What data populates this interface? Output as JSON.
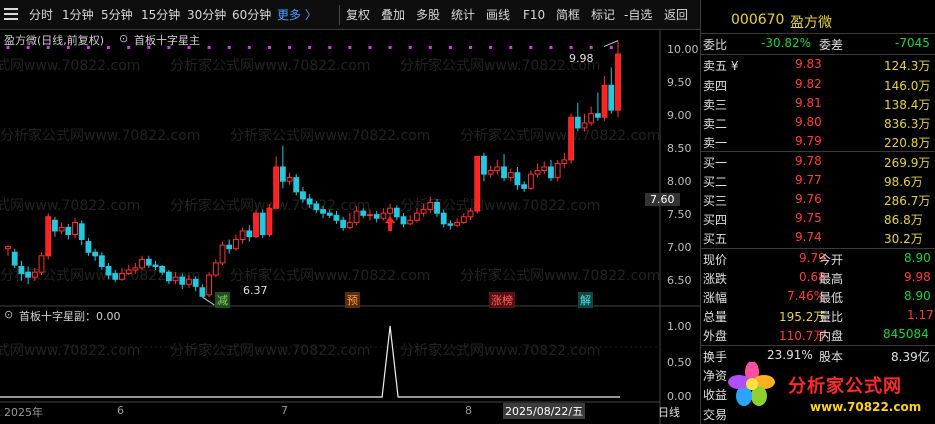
{
  "toolbar": {
    "tabs": [
      "分时",
      "1分钟",
      "5分钟",
      "15分钟",
      "30分钟",
      "60分钟"
    ],
    "more": "更多 〉",
    "buttons": [
      "复权",
      "叠加",
      "多股",
      "统计",
      "画线",
      "F10",
      "简框",
      "标记",
      "-自选",
      "返回"
    ]
  },
  "chart": {
    "title": "盈方微(日线,前复权)",
    "indicator_main": "首板十字星主",
    "indicator_sub": "首板十字星副：0.00",
    "high_label": "9.98",
    "low_label": "6.37",
    "current_price_tag": "7.60",
    "y_ticks": [
      "10.00",
      "9.50",
      "9.00",
      "8.50",
      "8.00",
      "7.50",
      "7.00",
      "6.50"
    ],
    "sub_y_ticks": [
      "1.00",
      "0.50",
      "0.00"
    ],
    "x_ticks": [
      "2025年",
      "6",
      "7",
      "8"
    ],
    "date_highlight": "2025/08/22/五",
    "period_label": "日线",
    "signals": [
      {
        "text": "减",
        "color": "#2ecc40"
      },
      {
        "text": "预",
        "color": "#ff7f00"
      },
      {
        "text": "涨榜",
        "color": "#ff3b3b"
      },
      {
        "text": "解",
        "color": "#21c6c6"
      }
    ],
    "watermark": "分析家公式网www.70822.com",
    "chart_data": {
      "type": "candlestick",
      "ylim": [
        6.3,
        10.1
      ],
      "candles": [
        [
          7.05,
          7.08,
          6.95,
          7.1
        ],
        [
          7.0,
          6.82,
          6.78,
          7.05
        ],
        [
          6.8,
          6.7,
          6.6,
          6.88
        ],
        [
          6.72,
          6.65,
          6.55,
          6.8
        ],
        [
          6.65,
          6.72,
          6.6,
          6.78
        ],
        [
          6.72,
          6.95,
          6.68,
          7.0
        ],
        [
          6.95,
          7.5,
          6.9,
          7.55
        ],
        [
          7.45,
          7.3,
          7.22,
          7.5
        ],
        [
          7.3,
          7.35,
          7.25,
          7.42
        ],
        [
          7.35,
          7.25,
          7.18,
          7.4
        ],
        [
          7.25,
          7.42,
          7.2,
          7.48
        ],
        [
          7.4,
          7.18,
          7.1,
          7.45
        ],
        [
          7.15,
          7.0,
          6.95,
          7.2
        ],
        [
          7.0,
          6.95,
          6.88,
          7.05
        ],
        [
          6.95,
          6.8,
          6.75,
          7.0
        ],
        [
          6.8,
          6.68,
          6.62,
          6.85
        ],
        [
          6.7,
          6.62,
          6.58,
          6.75
        ],
        [
          6.62,
          6.7,
          6.6,
          6.78
        ],
        [
          6.7,
          6.75,
          6.68,
          6.82
        ],
        [
          6.75,
          6.78,
          6.7,
          6.85
        ],
        [
          6.78,
          6.9,
          6.75,
          6.95
        ],
        [
          6.9,
          6.82,
          6.78,
          6.95
        ],
        [
          6.82,
          6.8,
          6.75,
          6.88
        ],
        [
          6.8,
          6.72,
          6.68,
          6.82
        ],
        [
          6.72,
          6.6,
          6.55,
          6.75
        ],
        [
          6.6,
          6.65,
          6.55,
          6.72
        ],
        [
          6.65,
          6.55,
          6.48,
          6.7
        ],
        [
          6.55,
          6.62,
          6.5,
          6.68
        ],
        [
          6.62,
          6.52,
          6.45,
          6.66
        ],
        [
          6.5,
          6.38,
          6.37,
          6.55
        ],
        [
          6.4,
          6.68,
          6.37,
          6.72
        ],
        [
          6.68,
          6.85,
          6.65,
          6.9
        ],
        [
          6.85,
          7.1,
          6.82,
          7.15
        ],
        [
          7.1,
          7.05,
          6.98,
          7.18
        ],
        [
          7.05,
          7.18,
          7.02,
          7.25
        ],
        [
          7.18,
          7.3,
          7.12,
          7.35
        ],
        [
          7.3,
          7.22,
          7.15,
          7.38
        ],
        [
          7.22,
          7.55,
          7.2,
          7.6
        ],
        [
          7.55,
          7.25,
          7.2,
          7.6
        ],
        [
          7.25,
          7.62,
          7.22,
          7.68
        ],
        [
          7.62,
          8.2,
          7.6,
          8.35
        ],
        [
          8.2,
          8.0,
          7.9,
          8.5
        ],
        [
          8.0,
          8.05,
          7.95,
          8.12
        ],
        [
          8.05,
          7.85,
          7.8,
          8.1
        ],
        [
          7.85,
          7.75,
          7.7,
          7.92
        ],
        [
          7.75,
          7.68,
          7.62,
          7.82
        ],
        [
          7.68,
          7.6,
          7.55,
          7.72
        ],
        [
          7.6,
          7.55,
          7.48,
          7.65
        ],
        [
          7.55,
          7.52,
          7.48,
          7.6
        ],
        [
          7.52,
          7.45,
          7.4,
          7.58
        ],
        [
          7.45,
          7.35,
          7.3,
          7.5
        ],
        [
          7.35,
          7.42,
          7.32,
          7.55
        ],
        [
          7.42,
          7.58,
          7.38,
          7.65
        ],
        [
          7.58,
          7.52,
          7.48,
          7.62
        ],
        [
          7.52,
          7.53,
          7.45,
          7.6
        ],
        [
          7.53,
          7.48,
          7.42,
          7.58
        ],
        [
          7.48,
          7.55,
          7.45,
          7.62
        ],
        [
          7.55,
          7.62,
          7.5,
          7.68
        ],
        [
          7.62,
          7.5,
          7.45,
          7.66
        ],
        [
          7.5,
          7.4,
          7.35,
          7.55
        ],
        [
          7.4,
          7.45,
          7.38,
          7.52
        ],
        [
          7.45,
          7.55,
          7.42,
          7.62
        ],
        [
          7.55,
          7.6,
          7.5,
          7.68
        ],
        [
          7.6,
          7.7,
          7.55,
          7.78
        ],
        [
          7.7,
          7.55,
          7.5,
          7.75
        ],
        [
          7.55,
          7.4,
          7.35,
          7.6
        ],
        [
          7.4,
          7.38,
          7.32,
          7.45
        ],
        [
          7.38,
          7.42,
          7.35,
          7.48
        ],
        [
          7.42,
          7.5,
          7.4,
          7.55
        ],
        [
          7.5,
          7.58,
          7.45,
          7.62
        ],
        [
          7.58,
          8.35,
          7.55,
          8.35
        ],
        [
          8.35,
          8.1,
          8.0,
          8.4
        ],
        [
          8.1,
          8.15,
          8.05,
          8.22
        ],
        [
          8.15,
          8.2,
          8.1,
          8.3
        ],
        [
          8.2,
          8.05,
          8.0,
          8.38
        ],
        [
          8.05,
          8.12,
          8.0,
          8.18
        ],
        [
          8.12,
          7.95,
          7.88,
          8.2
        ],
        [
          7.95,
          7.9,
          7.85,
          8.0
        ],
        [
          7.9,
          8.1,
          7.88,
          8.15
        ],
        [
          8.1,
          8.15,
          8.05,
          8.25
        ],
        [
          8.15,
          8.2,
          8.1,
          8.28
        ],
        [
          8.2,
          8.05,
          8.0,
          8.3
        ],
        [
          8.05,
          8.25,
          8.0,
          8.3
        ],
        [
          8.25,
          8.3,
          8.18,
          8.4
        ],
        [
          8.3,
          8.9,
          8.25,
          8.95
        ],
        [
          8.9,
          8.75,
          8.7,
          9.1
        ],
        [
          8.75,
          8.82,
          8.7,
          8.95
        ],
        [
          8.82,
          8.95,
          8.78,
          9.05
        ],
        [
          8.95,
          8.9,
          8.85,
          9.25
        ],
        [
          8.9,
          9.35,
          8.85,
          9.48
        ],
        [
          9.35,
          9.0,
          8.95,
          9.6
        ],
        [
          9.0,
          9.79,
          8.9,
          9.98
        ]
      ],
      "signal_bar": 57
    }
  },
  "quote": {
    "code": "000670",
    "name": "盈方微",
    "weibi_label": "委比",
    "weibi_value": "-30.82%",
    "weicha_label": "委差",
    "weicha_value": "-7045",
    "asks": [
      {
        "label": "卖五 ¥",
        "price": "9.83",
        "vol": "124.3万"
      },
      {
        "label": "卖四",
        "price": "9.82",
        "vol": "146.0万"
      },
      {
        "label": "卖三",
        "price": "9.81",
        "vol": "138.4万"
      },
      {
        "label": "卖二",
        "price": "9.80",
        "vol": "836.3万"
      },
      {
        "label": "卖一",
        "price": "9.79",
        "vol": "220.8万"
      }
    ],
    "bids": [
      {
        "label": "买一",
        "price": "9.78",
        "vol": "269.9万"
      },
      {
        "label": "买二",
        "price": "9.77",
        "vol": "98.6万"
      },
      {
        "label": "买三",
        "price": "9.76",
        "vol": "286.7万"
      },
      {
        "label": "买四",
        "price": "9.75",
        "vol": "86.8万"
      },
      {
        "label": "买五",
        "price": "9.74",
        "vol": "30.2万"
      }
    ],
    "stats": [
      {
        "l1": "现价",
        "v1": "9.79",
        "c1": "red",
        "l2": "今开",
        "v2": "8.90",
        "c2": "green"
      },
      {
        "l1": "涨跌",
        "v1": "0.68",
        "c1": "red",
        "l2": "最高",
        "v2": "9.98",
        "c2": "red"
      },
      {
        "l1": "涨幅",
        "v1": "7.46%",
        "c1": "red",
        "l2": "最低",
        "v2": "8.90",
        "c2": "green"
      },
      {
        "l1": "总量",
        "v1": "195.2万",
        "c1": "yellow",
        "l2": "量比",
        "v2": "1.17",
        "c2": "red"
      },
      {
        "l1": "外盘",
        "v1": "110.7万",
        "c1": "red",
        "l2": "内盘",
        "v2": "845084",
        "c2": "green"
      }
    ],
    "turnover_label": "换手",
    "turnover_value": "23.91%",
    "equity_label": "股本",
    "equity_value": "8.39亿",
    "jingzi_label": "净资",
    "shouyi_label": "收益",
    "jiaoyi_label": "交易"
  },
  "logo": {
    "title": "分析家公式网",
    "url": "www.70822.com"
  }
}
